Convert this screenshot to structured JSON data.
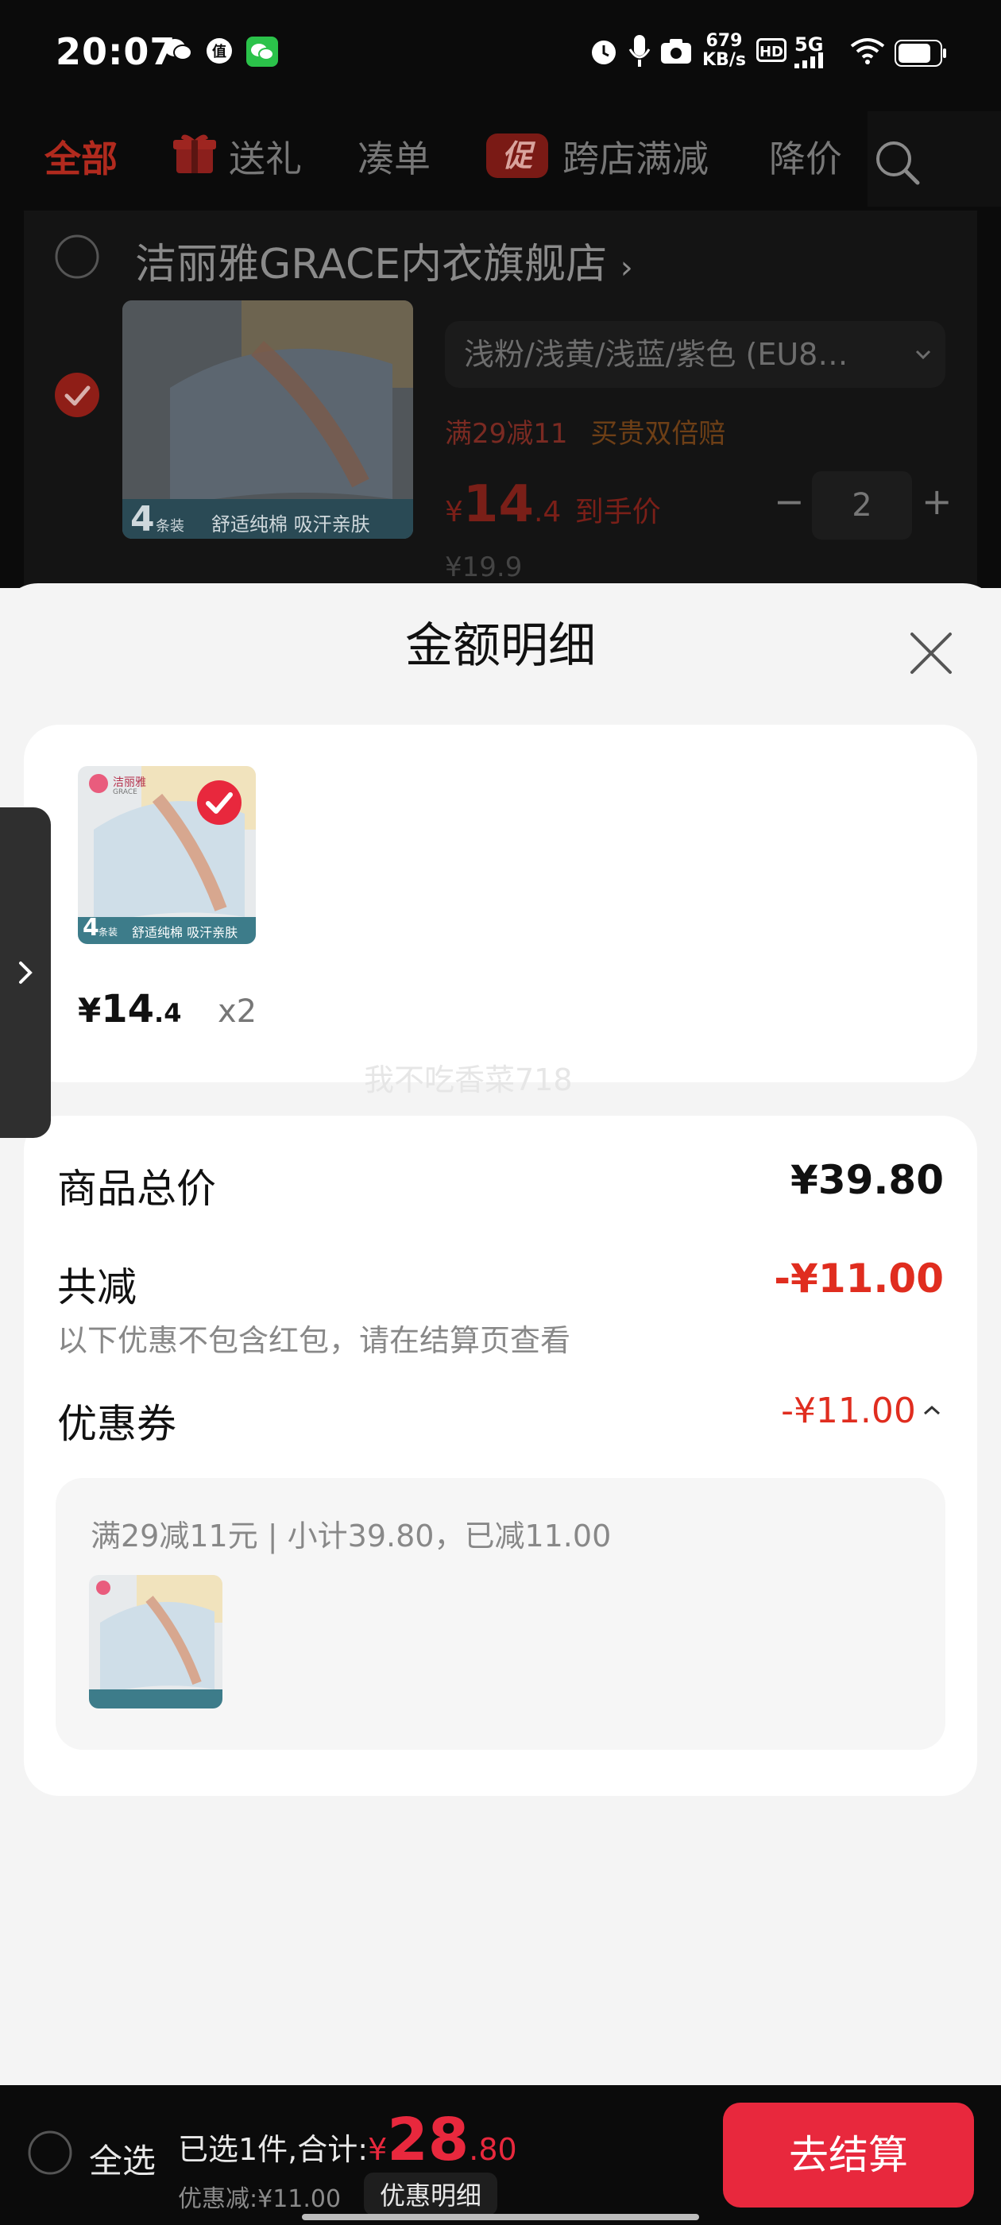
{
  "status_bar": {
    "time": "20:07",
    "net_speed_value": "679",
    "net_speed_unit": "KB/s",
    "hd": "HD",
    "network": "5G"
  },
  "tabs": [
    {
      "label": "全部",
      "active": true
    },
    {
      "label": "送礼"
    },
    {
      "label": "凑单"
    },
    {
      "label": "跨店满减",
      "badge": "促"
    },
    {
      "label": "降价"
    }
  ],
  "shop": {
    "name": "洁丽雅GRACE内衣旗舰店",
    "chevron": "›",
    "variant": "浅粉/浅黄/浅蓝/紫色 (EU8…",
    "promo": "满29减11",
    "promo_extra": "买贵双倍赔",
    "price_symbol": "¥",
    "price_int": "14",
    "price_dec": ".4",
    "price_suffix": "到手价",
    "qty_minus": "−",
    "qty": "2",
    "qty_plus": "+",
    "original_price": "¥19.9",
    "img_badge_count": "4",
    "img_badge_unit": "条装",
    "img_caption": "舒适纯棉 吸汗亲肤"
  },
  "sheet": {
    "title": "金额明细",
    "item_price_symbol": "¥",
    "item_price_int": "14",
    "item_price_dec": ".4",
    "item_qty": "x2",
    "watermark": "我不吃香菜718",
    "brand_mark": "洁丽雅",
    "brand_sub": "GRACE",
    "summary": {
      "total_label": "商品总价",
      "total_value": "¥39.80",
      "discount_label": "共减",
      "discount_value": "-¥11.00",
      "discount_note": "以下优惠不包含红包，请在结算页查看",
      "coupon_label": "优惠券",
      "coupon_value": "-¥11.00",
      "coupon_detail": "满29减11元 | 小计39.80，已减11.00"
    }
  },
  "bottom": {
    "select_all": "全选",
    "selected_text": "已选1件,合计:",
    "total_symbol": "¥",
    "total_int": "28",
    "total_dec": ".80",
    "discount_text": "优惠减:¥11.00",
    "detail_button": "优惠明细",
    "checkout": "去结算"
  },
  "colors": {
    "accent": "#e8283d",
    "discount_red": "#e02d1f",
    "dim_bg": "#0b0b0b"
  }
}
